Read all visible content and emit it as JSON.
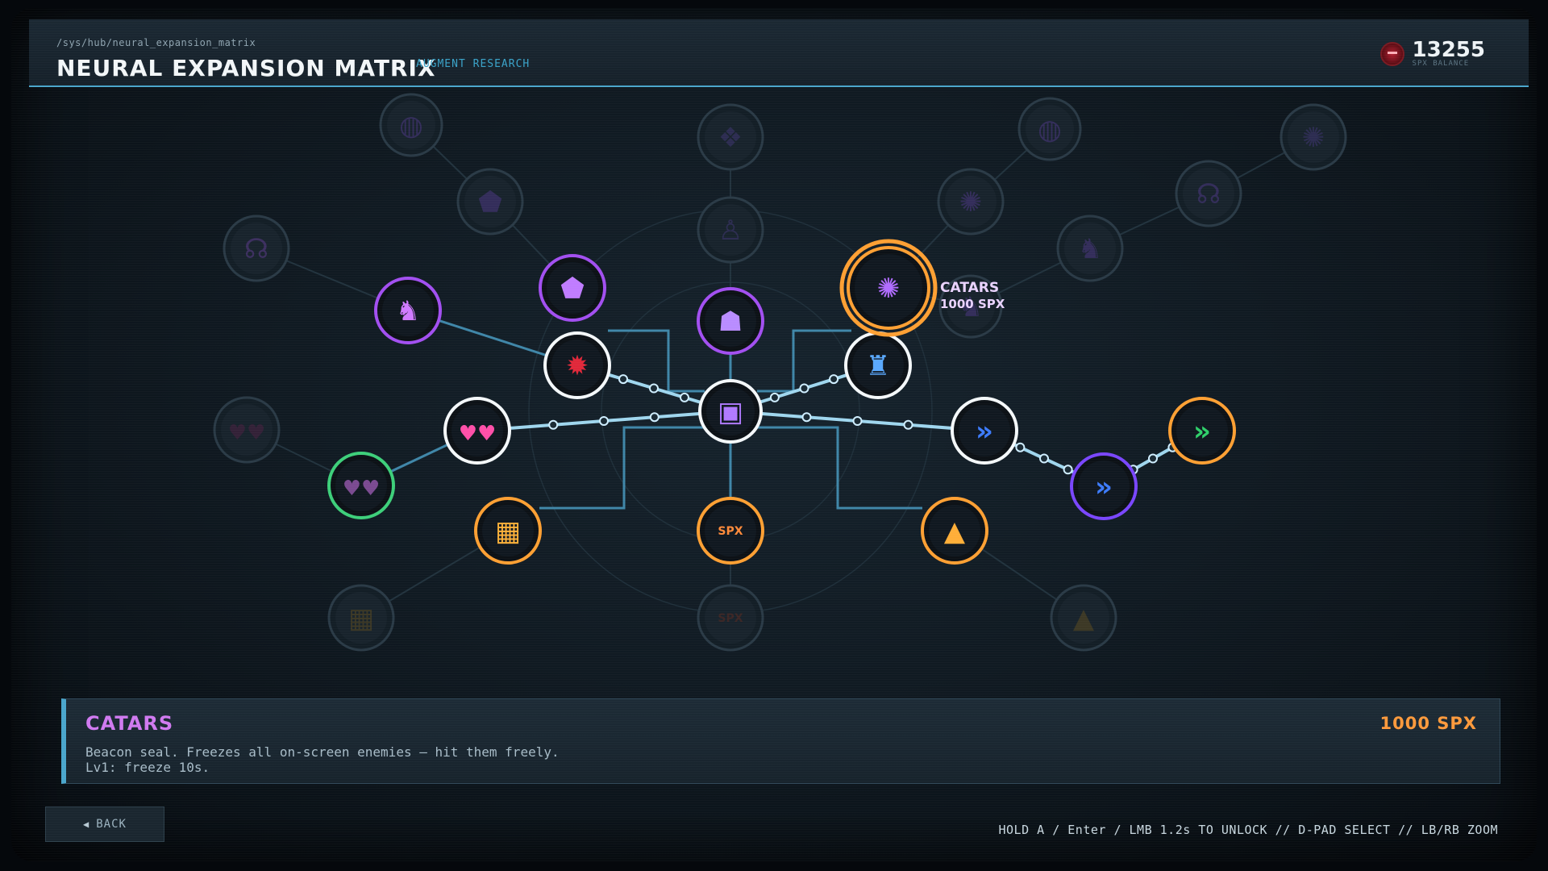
{
  "header": {
    "breadcrumb": "/sys/hub/neural_expansion_matrix",
    "title": "NEURAL EXPANSION MATRIX",
    "subtitle": "AUGMENT RESEARCH",
    "currency_amount": "13255",
    "currency_label": "SPX BALANCE",
    "currency_icon": "spx-coin-icon"
  },
  "tooltip": {
    "name": "CATARS",
    "cost": "1000 SPX"
  },
  "info": {
    "name": "CATARS",
    "cost": "1000 SPX",
    "description_line1": "Beacon seal. Freezes all on-screen enemies — hit them freely.",
    "description_line2": "Lv1: freeze 10s."
  },
  "footer": {
    "back_label": "BACK",
    "controls_hint": "HOLD A / Enter / LMB 1.2s TO UNLOCK  //  D-PAD SELECT  //  LB/RB ZOOM"
  },
  "colors": {
    "accent": "#4aa6cc",
    "purple": "#a24ff0",
    "orange": "#ffa033",
    "green": "#3dcf7a",
    "blue": "#4a7bff",
    "owned": "#f4f8fa",
    "tooltip_text": "#ead3ff"
  },
  "nodes": [
    {
      "id": "core",
      "icon": "core-cube-icon",
      "ring": "owned",
      "state": "owned",
      "glyph": "▣",
      "glyph_color": "#b07aff"
    },
    {
      "id": "crimson-armor",
      "icon": "crimson-armor-icon",
      "ring": "owned",
      "state": "owned",
      "glyph": "✹",
      "glyph_color": "#e0283a"
    },
    {
      "id": "twin-hearts",
      "icon": "twin-hearts-icon",
      "ring": "owned",
      "state": "owned",
      "glyph": "♥♥",
      "glyph_color": "#ff4fa8"
    },
    {
      "id": "cyber-knight",
      "icon": "cyber-knight-icon",
      "ring": "owned",
      "state": "owned",
      "glyph": "♜",
      "glyph_color": "#5aa9ff"
    },
    {
      "id": "blue-dash",
      "icon": "blue-dash-icon",
      "ring": "owned",
      "state": "owned",
      "glyph": "»",
      "glyph_color": "#3d7cff"
    },
    {
      "id": "cyber-shield",
      "icon": "cyber-shield-icon",
      "ring": "purple",
      "state": "available",
      "glyph": "⬟",
      "glyph_color": "#c07cff"
    },
    {
      "id": "phantom",
      "icon": "phantom-icon",
      "ring": "purple",
      "state": "available",
      "glyph": "☗",
      "glyph_color": "#b98cff"
    },
    {
      "id": "catars",
      "icon": "catars-seal-icon",
      "ring": "orange",
      "state": "selected",
      "glyph": "✺",
      "glyph_color": "#b06cff"
    },
    {
      "id": "guardian",
      "icon": "guardian-icon",
      "ring": "purple",
      "state": "available",
      "glyph": "♞",
      "glyph_color": "#d07aff"
    },
    {
      "id": "green-hearts",
      "icon": "green-hearts-icon",
      "ring": "green",
      "state": "available",
      "glyph": "♥♥",
      "glyph_color": "#7a4a90"
    },
    {
      "id": "chip",
      "icon": "chip-icon",
      "ring": "orange",
      "state": "available",
      "glyph": "▦",
      "glyph_color": "#ffb23a"
    },
    {
      "id": "spx-core",
      "icon": "spx-core-icon",
      "ring": "orange",
      "state": "available",
      "glyph": "SPX",
      "glyph_color": "#ff8a3a"
    },
    {
      "id": "sigil",
      "icon": "sigil-icon",
      "ring": "orange",
      "state": "available",
      "glyph": "▲",
      "glyph_color": "#ffae38"
    },
    {
      "id": "violet-dash",
      "icon": "violet-dash-icon",
      "ring": "purple-bright",
      "state": "available",
      "glyph": "»",
      "glyph_color": "#3d7cff"
    },
    {
      "id": "green-dash",
      "icon": "green-dash-icon",
      "ring": "orange",
      "state": "available",
      "glyph": "»",
      "glyph_color": "#2fcf6a"
    },
    {
      "id": "locked-tl1",
      "icon": "locked-creature-icon",
      "ring": "locked",
      "state": "locked",
      "glyph": "☊",
      "glyph_color": "#5a3a8a"
    },
    {
      "id": "locked-tl2",
      "icon": "locked-mask-icon",
      "ring": "locked",
      "state": "locked",
      "glyph": "⬟",
      "glyph_color": "#4a3680"
    },
    {
      "id": "locked-tl3",
      "icon": "locked-orb-icon",
      "ring": "locked",
      "state": "locked",
      "glyph": "◍",
      "glyph_color": "#4a3680"
    },
    {
      "id": "locked-tc1",
      "icon": "locked-figure-icon",
      "ring": "locked",
      "state": "locked",
      "glyph": "♙",
      "glyph_color": "#3e3470"
    },
    {
      "id": "locked-tc2",
      "icon": "locked-glyph-icon",
      "ring": "locked",
      "state": "locked",
      "glyph": "❖",
      "glyph_color": "#3e3470"
    },
    {
      "id": "locked-tr1",
      "icon": "locked-seal-icon",
      "ring": "locked",
      "state": "locked",
      "glyph": "✺",
      "glyph_color": "#4a3680"
    },
    {
      "id": "locked-tr2",
      "icon": "locked-beast-icon",
      "ring": "locked",
      "state": "locked",
      "glyph": "♞",
      "glyph_color": "#4a3680"
    },
    {
      "id": "locked-tr3",
      "icon": "locked-creature-icon",
      "ring": "locked",
      "state": "locked",
      "glyph": "☊",
      "glyph_color": "#4a3680"
    },
    {
      "id": "locked-tr4",
      "icon": "locked-beast-icon",
      "ring": "locked",
      "state": "locked",
      "glyph": "♞",
      "glyph_color": "#4a3680"
    },
    {
      "id": "locked-tr5",
      "icon": "locked-orb-icon",
      "ring": "locked",
      "state": "locked",
      "glyph": "◍",
      "glyph_color": "#4a3680"
    },
    {
      "id": "locked-tr6",
      "icon": "locked-seal-icon",
      "ring": "locked",
      "state": "locked",
      "glyph": "✺",
      "glyph_color": "#3e3470"
    },
    {
      "id": "locked-l",
      "icon": "locked-hearts-icon",
      "ring": "locked",
      "state": "locked",
      "glyph": "♥♥",
      "glyph_color": "#4a2040"
    },
    {
      "id": "locked-bl",
      "icon": "locked-chip-icon",
      "ring": "locked",
      "state": "locked",
      "glyph": "▦",
      "glyph_color": "#5a4a20"
    },
    {
      "id": "locked-bc",
      "icon": "locked-spx-icon",
      "ring": "locked",
      "state": "locked",
      "glyph": "SPX",
      "glyph_color": "#5a2a20"
    },
    {
      "id": "locked-br",
      "icon": "locked-sigil-icon",
      "ring": "locked",
      "state": "locked",
      "glyph": "▲",
      "glyph_color": "#5a4a20"
    }
  ]
}
